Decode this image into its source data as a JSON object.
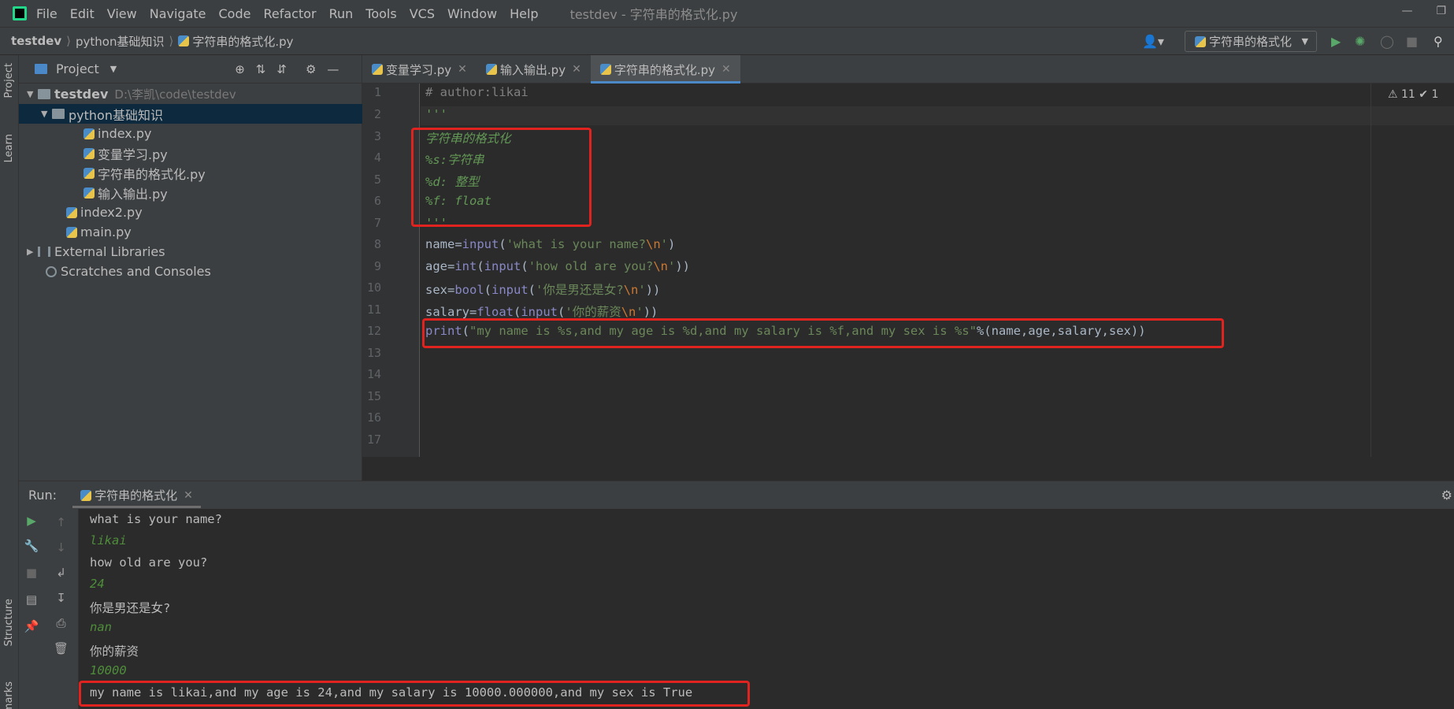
{
  "menubar": {
    "items": [
      "File",
      "Edit",
      "View",
      "Navigate",
      "Code",
      "Refactor",
      "Run",
      "Tools",
      "VCS",
      "Window",
      "Help"
    ],
    "window_title": "testdev - 字符串的格式化.py"
  },
  "navbar": {
    "breadcrumbs": [
      "testdev",
      "python基础知识",
      "字符串的格式化.py"
    ],
    "run_config": "字符串的格式化"
  },
  "side_tabs": {
    "project": "Project",
    "learn": "Learn",
    "structure": "Structure",
    "bookmarks": "marks"
  },
  "project": {
    "title": "Project",
    "tree": [
      {
        "label": "testdev",
        "hint": "D:\\李凯\\code\\testdev"
      },
      {
        "label": "python基础知识"
      },
      {
        "label": "index.py"
      },
      {
        "label": "变量学习.py"
      },
      {
        "label": "字符串的格式化.py"
      },
      {
        "label": "输入输出.py"
      },
      {
        "label": "index2.py"
      },
      {
        "label": "main.py"
      },
      {
        "label": "External Libraries"
      },
      {
        "label": "Scratches and Consoles"
      }
    ]
  },
  "editor": {
    "tabs": [
      "变量学习.py",
      "输入输出.py",
      "字符串的格式化.py"
    ],
    "line_numbers": [
      "1",
      "2",
      "3",
      "4",
      "5",
      "6",
      "7",
      "8",
      "9",
      "10",
      "11",
      "12",
      "13",
      "14",
      "15",
      "16",
      "17"
    ],
    "inspections": "⚠ 11  ✔ 1",
    "code": {
      "l1": "# author:likai",
      "l2": "'''",
      "l3": "字符串的格式化",
      "l4": "%s:字符串",
      "l5": "%d: 整型",
      "l6": "%f: float",
      "l7": "'''",
      "l8_a": "name=",
      "l8_b": "input",
      "l8_c": "(",
      "l8_d": "'what is your name?",
      "l8_e": "\\n",
      "l8_f": "'",
      "l8_g": ")",
      "l9_a": "age=",
      "l9_b": "int",
      "l9_c": "(",
      "l9_d": "input",
      "l9_e": "(",
      "l9_f": "'how old are you?",
      "l9_g": "\\n",
      "l9_h": "'",
      "l9_i": "))",
      "l10_a": "sex=",
      "l10_b": "bool",
      "l10_c": "(",
      "l10_d": "input",
      "l10_e": "(",
      "l10_f": "'你是男还是女?",
      "l10_g": "\\n",
      "l10_h": "'",
      "l10_i": "))",
      "l11_a": "salary=",
      "l11_b": "float",
      "l11_c": "(",
      "l11_d": "input",
      "l11_e": "(",
      "l11_f": "'你的薪资",
      "l11_g": "\\n",
      "l11_h": "'",
      "l11_i": "))",
      "l12_a": "print",
      "l12_b": "(",
      "l12_c": "\"my name is %s,and my age is %d,and my salary is %f,and my sex is %s\"",
      "l12_d": "%(name,age,salary,sex))"
    }
  },
  "run": {
    "label": "Run:",
    "tab": "字符串的格式化",
    "output": [
      {
        "text": "what is your name?",
        "input": false
      },
      {
        "text": "likai",
        "input": true
      },
      {
        "text": "how old are you?",
        "input": false
      },
      {
        "text": "24",
        "input": true
      },
      {
        "text": "你是男还是女?",
        "input": false
      },
      {
        "text": "nan",
        "input": true
      },
      {
        "text": "你的薪资",
        "input": false
      },
      {
        "text": "10000",
        "input": true
      },
      {
        "text": "my name is likai,and my age is 24,and my salary is 10000.000000,and my sex is True",
        "input": false
      }
    ]
  },
  "colors": {
    "highlight_box": "#e0231e",
    "accent": "#4a88c7"
  }
}
